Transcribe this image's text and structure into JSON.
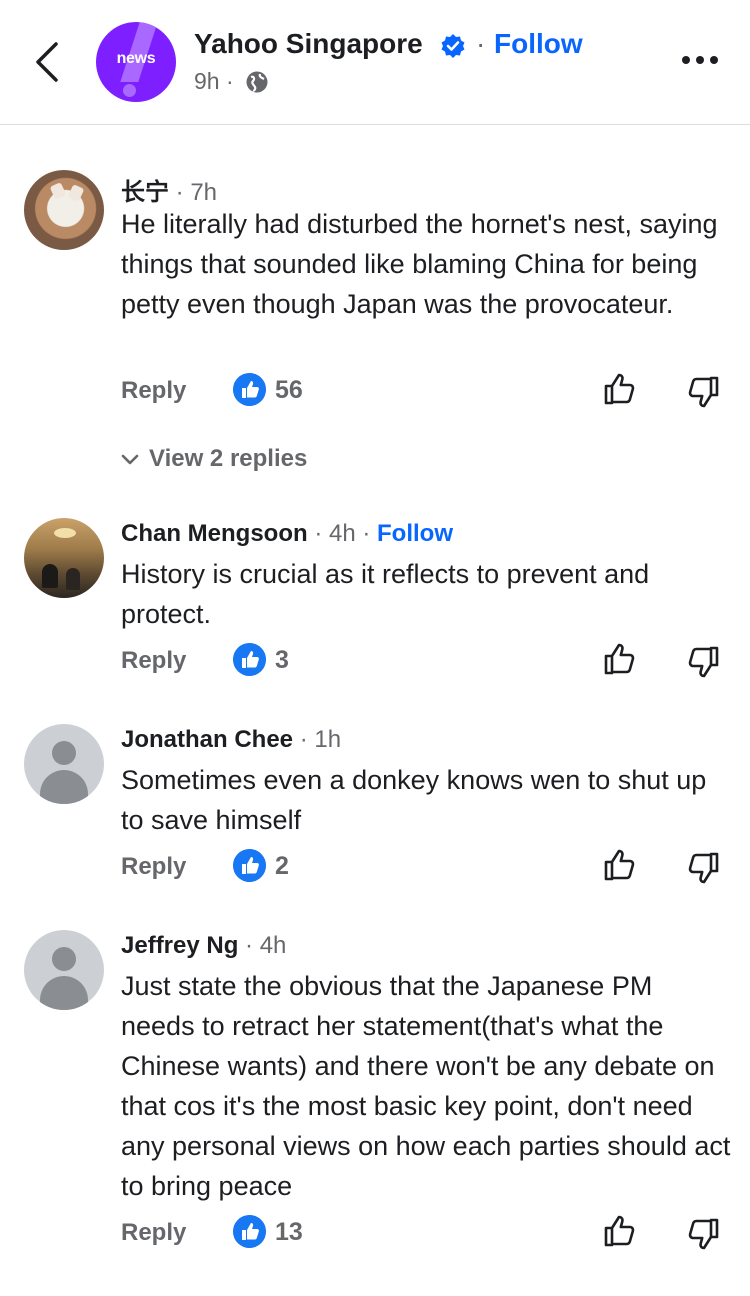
{
  "header": {
    "page_name": "Yahoo Singapore",
    "separator": "·",
    "follow_label": "Follow",
    "time": "9h ·",
    "logo_text": "news",
    "brand_color": "#7e1fff",
    "accent_color": "#0866ff",
    "icons": [
      "back-arrow-icon",
      "verified-badge-icon",
      "globe-icon",
      "more-icon"
    ]
  },
  "comments": [
    {
      "author": "长宁",
      "time": "· 7h",
      "text": "He literally had disturbed the hornet's nest, saying things that sounded like blaming China for being petty even though Japan was the provocateur.",
      "reply_label": "Reply",
      "likes": "56",
      "view_replies": "View 2 replies"
    },
    {
      "author": "Chan Mengsoon",
      "time": "· 4h ·",
      "follow_label": "Follow",
      "text": "History is crucial as it reflects to prevent and protect.",
      "reply_label": "Reply",
      "likes": "3"
    },
    {
      "author": "Jonathan Chee",
      "time": "· 1h",
      "text": "Sometimes even a donkey knows wen to shut up to save himself",
      "reply_label": "Reply",
      "likes": "2"
    },
    {
      "author": "Jeffrey Ng",
      "time": "· 4h",
      "text": "Just state the obvious that the Japanese PM needs to retract her statement(that's what the Chinese wants) and there won't be any debate on that cos it's the most basic key point, don't need any personal views on how each parties should act to bring peace",
      "reply_label": "Reply",
      "likes": "13"
    }
  ]
}
